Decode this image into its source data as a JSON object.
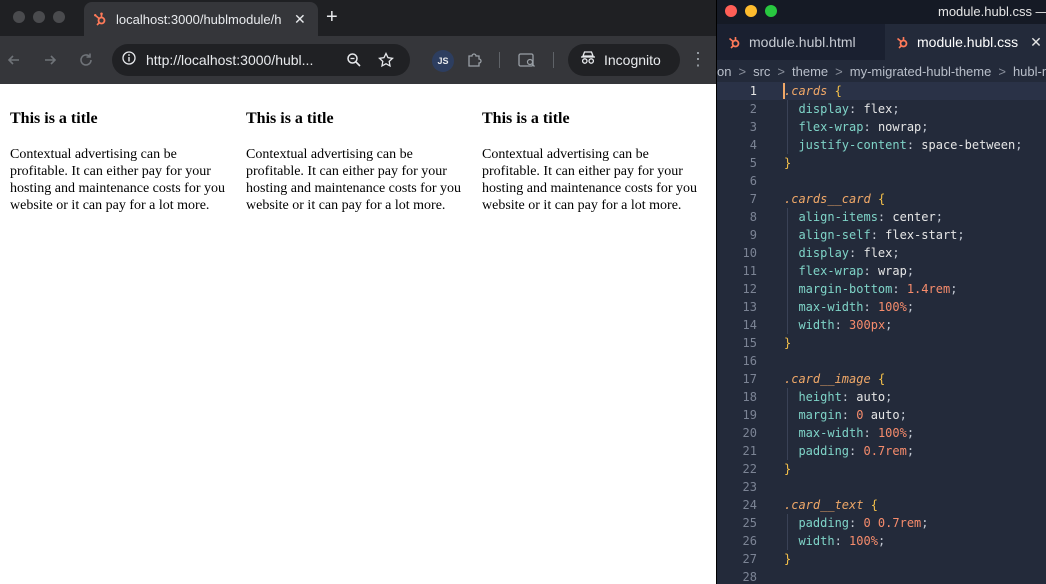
{
  "browser": {
    "tab": {
      "title": "localhost:3000/hublmodule/h",
      "close": "✕"
    },
    "new_tab": "+",
    "url": "http://localhost:3000/hubl...",
    "extension_badge": "JS",
    "incognito_label": "Incognito",
    "menu": "⋮"
  },
  "page": {
    "cards": [
      {
        "title": "This is a title",
        "text": "Contextual advertising can be profitable. It can either pay for your hosting and maintenance costs for you website or it can pay for a lot more."
      },
      {
        "title": "This is a title",
        "text": "Contextual advertising can be profitable. It can either pay for your hosting and maintenance costs for you website or it can pay for a lot more."
      },
      {
        "title": "This is a title",
        "text": "Contextual advertising can be profitable. It can either pay for your hosting and maintenance costs for you website or it can pay for a lot more."
      }
    ]
  },
  "editor": {
    "window_title": "module.hubl.css —",
    "tabs": [
      {
        "label": "module.hubl.html",
        "active": false
      },
      {
        "label": "module.hubl.css",
        "active": true,
        "close": "✕"
      }
    ],
    "breadcrumb": [
      "on",
      "src",
      "theme",
      "my-migrated-hubl-theme",
      "hubl-m"
    ],
    "current_line": 1,
    "lines": [
      [
        [
          "sel",
          ".cards"
        ],
        [
          "punc",
          " "
        ],
        [
          "brace",
          "{"
        ]
      ],
      [
        [
          "prop",
          "  display"
        ],
        [
          "punc",
          ": "
        ],
        [
          "val",
          "flex"
        ],
        [
          "punc",
          ";"
        ]
      ],
      [
        [
          "prop",
          "  flex-wrap"
        ],
        [
          "punc",
          ": "
        ],
        [
          "val",
          "nowrap"
        ],
        [
          "punc",
          ";"
        ]
      ],
      [
        [
          "prop",
          "  justify-content"
        ],
        [
          "punc",
          ": "
        ],
        [
          "val",
          "space-between"
        ],
        [
          "punc",
          ";"
        ]
      ],
      [
        [
          "brace",
          "}"
        ]
      ],
      [],
      [
        [
          "sel",
          ".cards__card"
        ],
        [
          "punc",
          " "
        ],
        [
          "brace",
          "{"
        ]
      ],
      [
        [
          "prop",
          "  align-items"
        ],
        [
          "punc",
          ": "
        ],
        [
          "val",
          "center"
        ],
        [
          "punc",
          ";"
        ]
      ],
      [
        [
          "prop",
          "  align-self"
        ],
        [
          "punc",
          ": "
        ],
        [
          "val",
          "flex-start"
        ],
        [
          "punc",
          ";"
        ]
      ],
      [
        [
          "prop",
          "  display"
        ],
        [
          "punc",
          ": "
        ],
        [
          "val",
          "flex"
        ],
        [
          "punc",
          ";"
        ]
      ],
      [
        [
          "prop",
          "  flex-wrap"
        ],
        [
          "punc",
          ": "
        ],
        [
          "val",
          "wrap"
        ],
        [
          "punc",
          ";"
        ]
      ],
      [
        [
          "prop",
          "  margin-bottom"
        ],
        [
          "punc",
          ": "
        ],
        [
          "num",
          "1.4"
        ],
        [
          "unit",
          "rem"
        ],
        [
          "punc",
          ";"
        ]
      ],
      [
        [
          "prop",
          "  max-width"
        ],
        [
          "punc",
          ": "
        ],
        [
          "num",
          "100"
        ],
        [
          "unit",
          "%"
        ],
        [
          "punc",
          ";"
        ]
      ],
      [
        [
          "prop",
          "  width"
        ],
        [
          "punc",
          ": "
        ],
        [
          "num",
          "300"
        ],
        [
          "unit",
          "px"
        ],
        [
          "punc",
          ";"
        ]
      ],
      [
        [
          "brace",
          "}"
        ]
      ],
      [],
      [
        [
          "sel",
          ".card__image"
        ],
        [
          "punc",
          " "
        ],
        [
          "brace",
          "{"
        ]
      ],
      [
        [
          "prop",
          "  height"
        ],
        [
          "punc",
          ": "
        ],
        [
          "val",
          "auto"
        ],
        [
          "punc",
          ";"
        ]
      ],
      [
        [
          "prop",
          "  margin"
        ],
        [
          "punc",
          ": "
        ],
        [
          "num",
          "0"
        ],
        [
          "val",
          " auto"
        ],
        [
          "punc",
          ";"
        ]
      ],
      [
        [
          "prop",
          "  max-width"
        ],
        [
          "punc",
          ": "
        ],
        [
          "num",
          "100"
        ],
        [
          "unit",
          "%"
        ],
        [
          "punc",
          ";"
        ]
      ],
      [
        [
          "prop",
          "  padding"
        ],
        [
          "punc",
          ": "
        ],
        [
          "num",
          "0.7"
        ],
        [
          "unit",
          "rem"
        ],
        [
          "punc",
          ";"
        ]
      ],
      [
        [
          "brace",
          "}"
        ]
      ],
      [],
      [
        [
          "sel",
          ".card__text"
        ],
        [
          "punc",
          " "
        ],
        [
          "brace",
          "{"
        ]
      ],
      [
        [
          "prop",
          "  padding"
        ],
        [
          "punc",
          ": "
        ],
        [
          "num",
          "0 0.7"
        ],
        [
          "unit",
          "rem"
        ],
        [
          "punc",
          ";"
        ]
      ],
      [
        [
          "prop",
          "  width"
        ],
        [
          "punc",
          ": "
        ],
        [
          "num",
          "100"
        ],
        [
          "unit",
          "%"
        ],
        [
          "punc",
          ";"
        ]
      ],
      [
        [
          "brace",
          "}"
        ]
      ],
      []
    ]
  }
}
